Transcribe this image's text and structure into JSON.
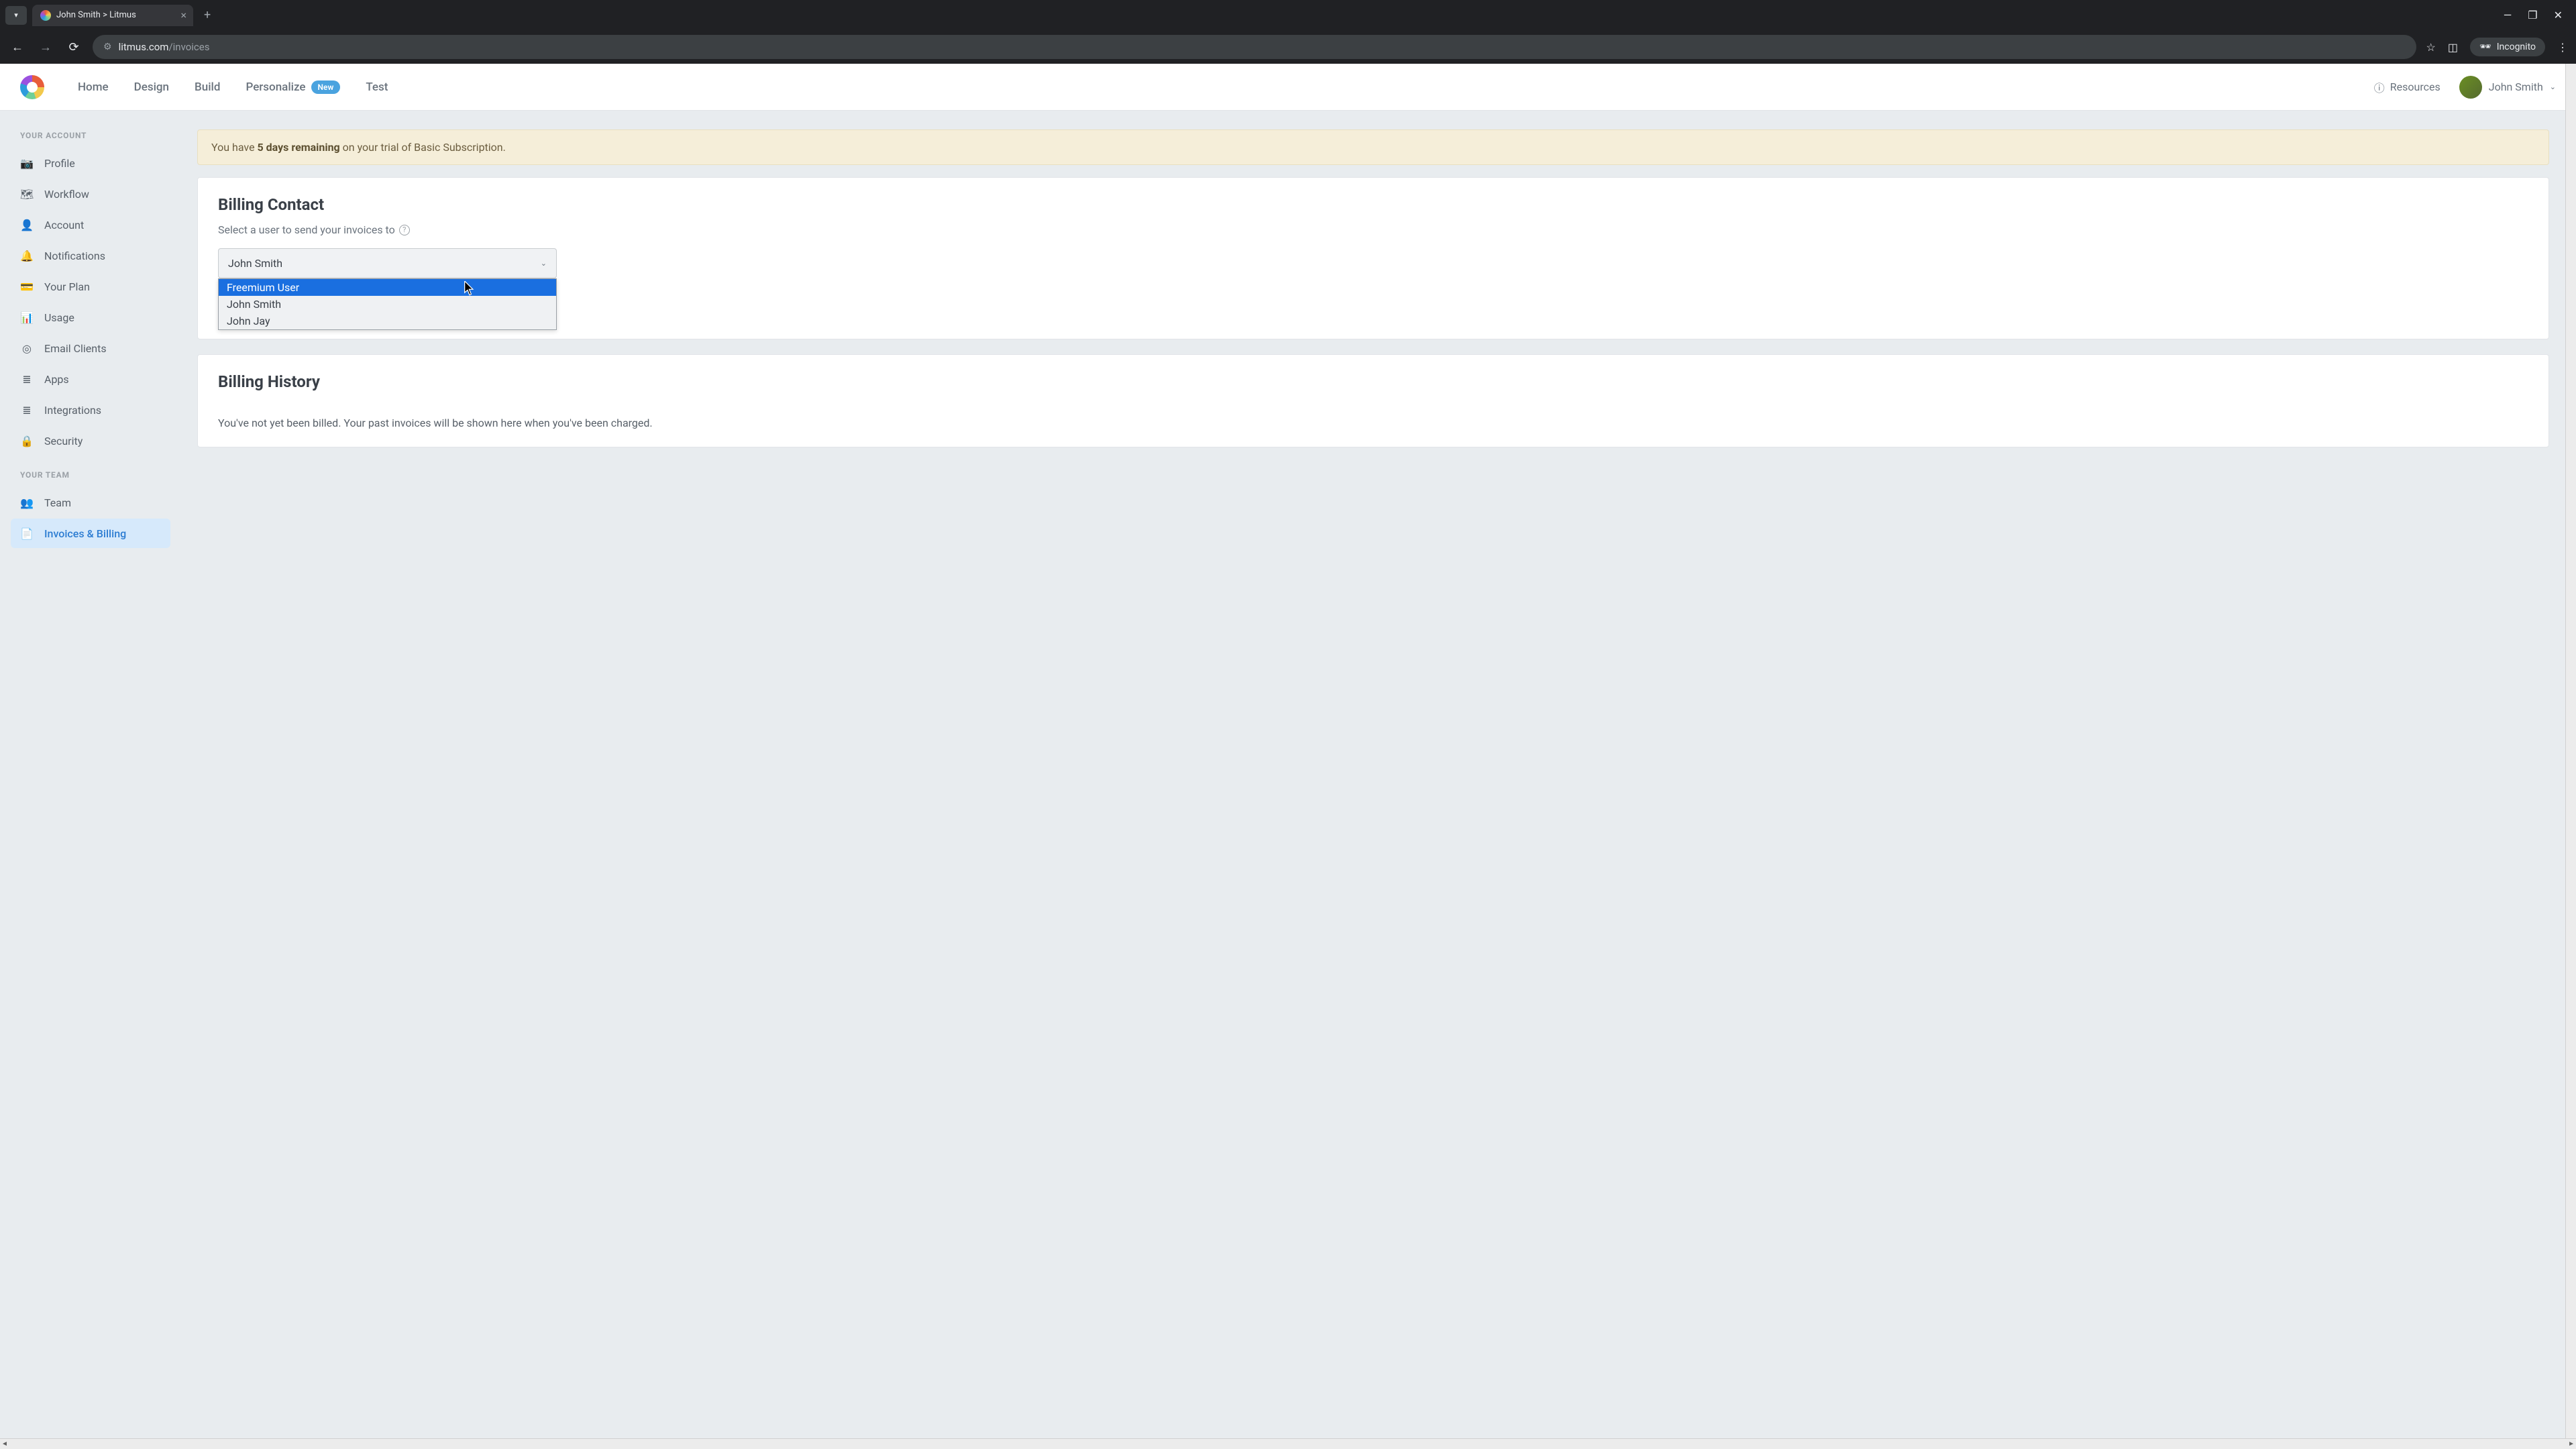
{
  "browser": {
    "tab_title": "John Smith > Litmus",
    "url_domain": "litmus.com",
    "url_path": "/invoices",
    "incognito_label": "Incognito"
  },
  "header": {
    "nav": [
      "Home",
      "Design",
      "Build",
      "Personalize",
      "Test"
    ],
    "personalize_badge": "New",
    "resources": "Resources",
    "user_name": "John Smith"
  },
  "sidebar": {
    "section1_title": "YOUR ACCOUNT",
    "section1_items": [
      {
        "label": "Profile",
        "icon": "camera"
      },
      {
        "label": "Workflow",
        "icon": "map"
      },
      {
        "label": "Account",
        "icon": "user"
      },
      {
        "label": "Notifications",
        "icon": "bell"
      },
      {
        "label": "Your Plan",
        "icon": "card"
      },
      {
        "label": "Usage",
        "icon": "bars"
      },
      {
        "label": "Email Clients",
        "icon": "toggle"
      },
      {
        "label": "Apps",
        "icon": "layers"
      },
      {
        "label": "Integrations",
        "icon": "layers"
      },
      {
        "label": "Security",
        "icon": "lock"
      }
    ],
    "section2_title": "YOUR TEAM",
    "section2_items": [
      {
        "label": "Team",
        "icon": "users"
      },
      {
        "label": "Invoices & Billing",
        "icon": "doc",
        "active": true
      }
    ]
  },
  "banner": {
    "prefix": "You have ",
    "bold": "5 days remaining",
    "suffix": " on your trial of Basic Subscription."
  },
  "billing_contact": {
    "title": "Billing Contact",
    "subtitle": "Select a user to send your invoices to",
    "selected": "John Smith",
    "options": [
      "Freemium User",
      "John Smith",
      "John Jay"
    ],
    "highlighted_index": 0
  },
  "billing_history": {
    "title": "Billing History",
    "body": "You've not yet been billed. Your past invoices will be shown here when you've been charged."
  }
}
